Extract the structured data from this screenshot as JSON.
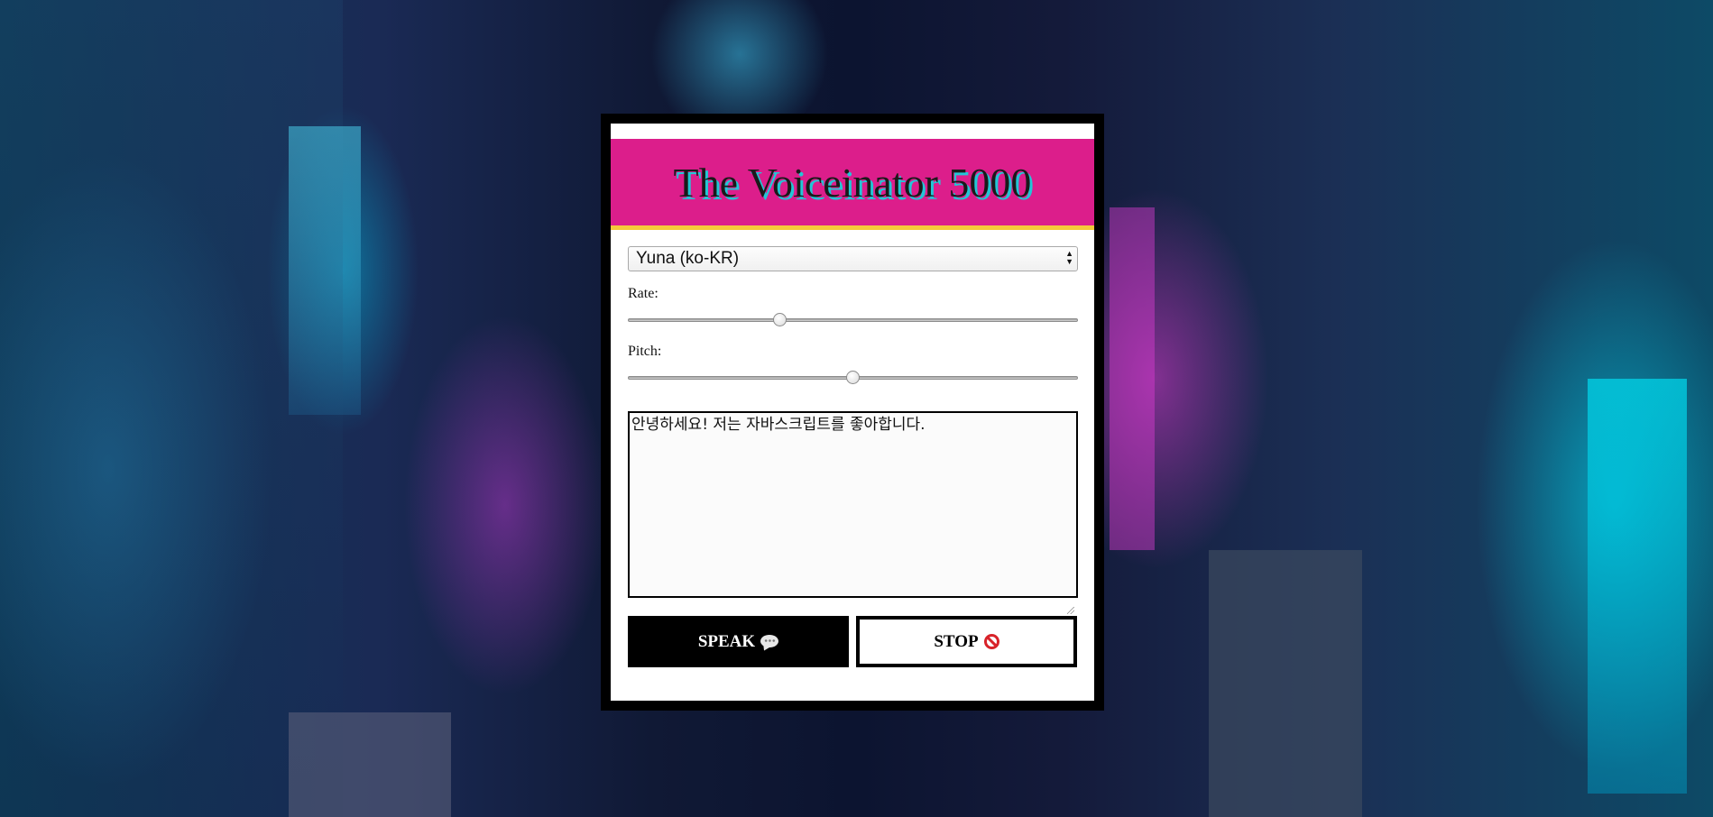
{
  "app": {
    "title": "The Voiceinator 5000"
  },
  "voice_select": {
    "selected": "Yuna (ko-KR)"
  },
  "rate": {
    "label": "Rate:",
    "value": 1,
    "min": 0,
    "max": 3
  },
  "pitch": {
    "label": "Pitch:",
    "value": 1,
    "min": 0,
    "max": 2
  },
  "message": {
    "text": "안녕하세요! 저는 자바스크립트를 좋아합니다."
  },
  "buttons": {
    "speak_label": "SPEAK",
    "speak_icon": "speech-balloon-icon",
    "stop_label": "STOP",
    "stop_icon": "prohibited-icon"
  },
  "colors": {
    "title_bar": "#dc1e8b",
    "title_border": "#f5c93a",
    "title_shadow": "#23c6d6",
    "card_border": "#000000"
  }
}
